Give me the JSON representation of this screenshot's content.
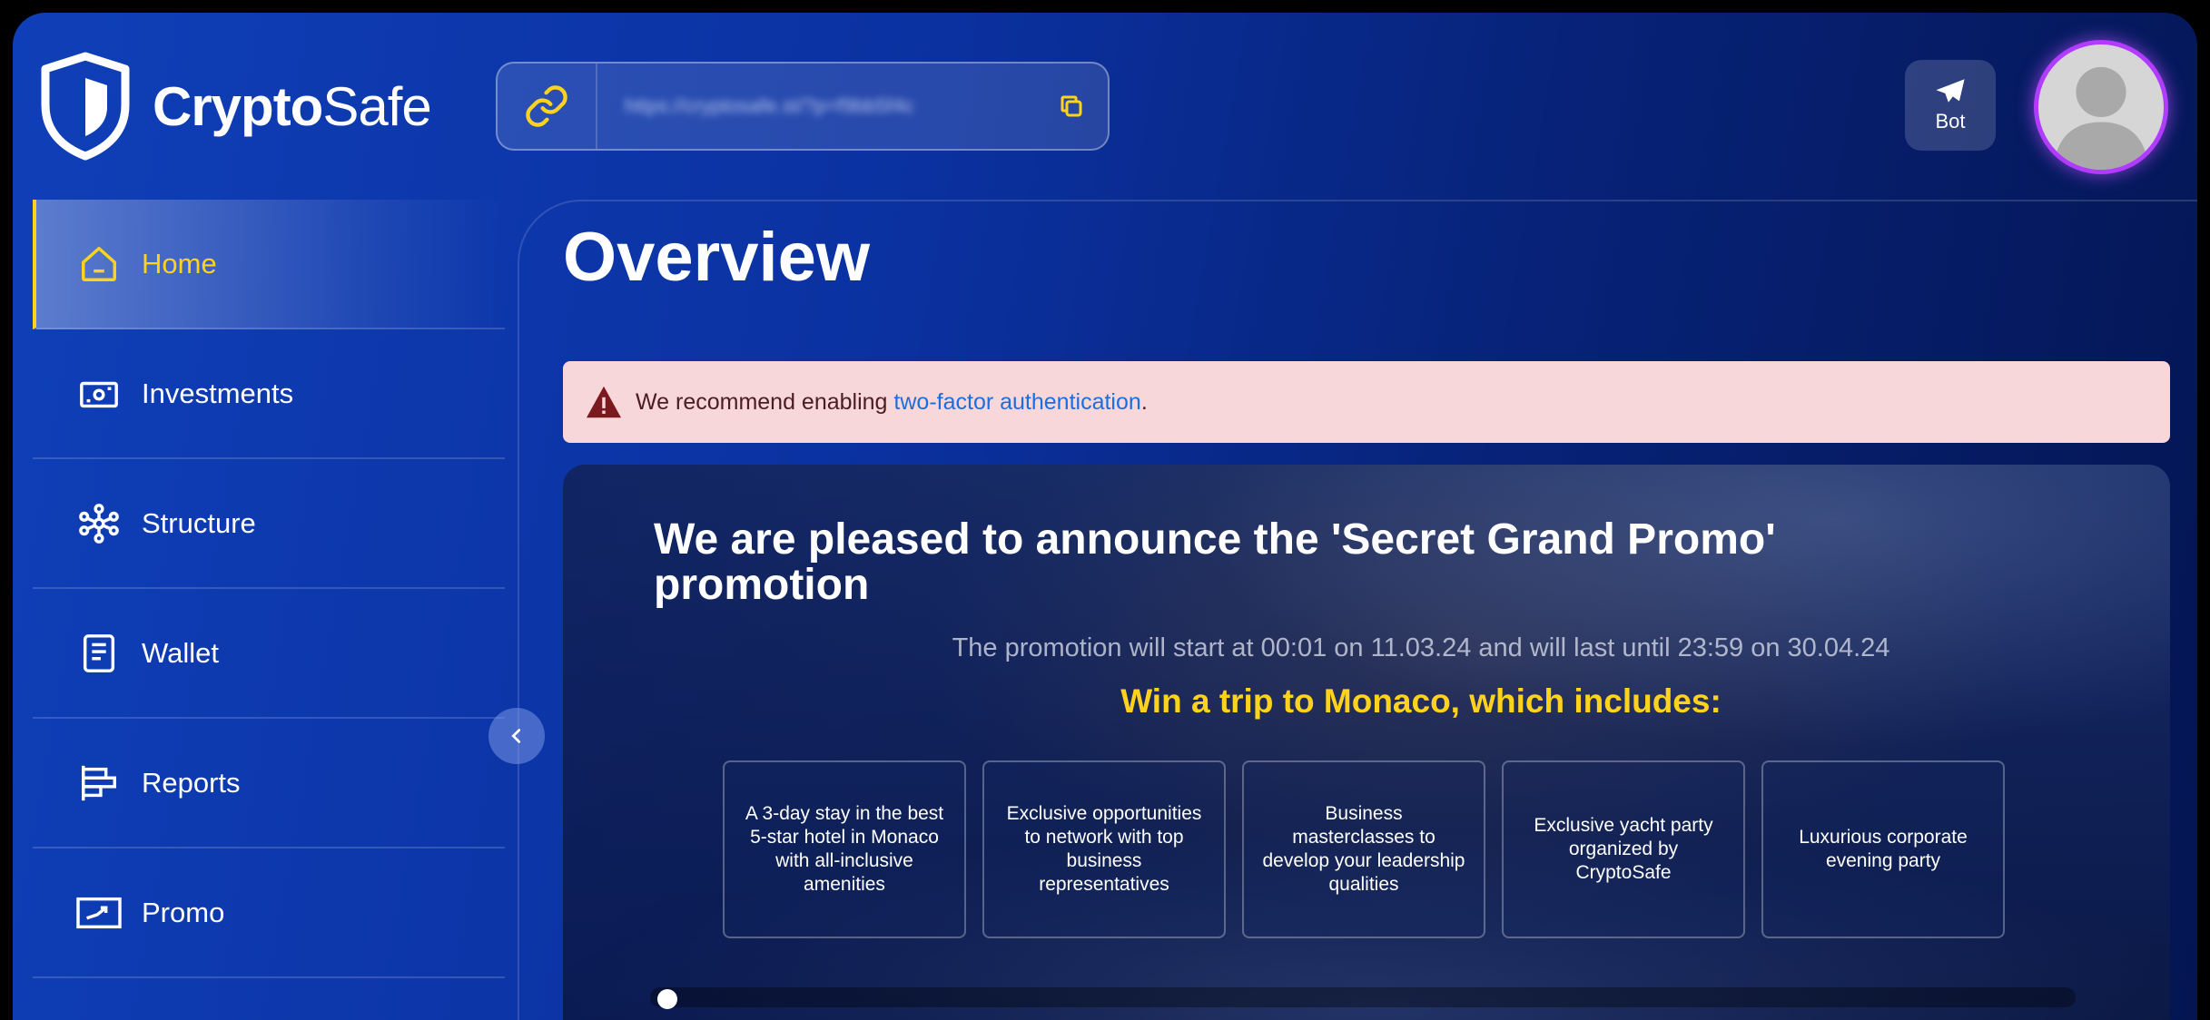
{
  "brand": {
    "name_bold": "Crypto",
    "name_light": "Safe"
  },
  "header": {
    "referral_url": "https://cryptosafe.st/?p=f9bb5f4c",
    "bot_label": "Bot"
  },
  "sidebar": {
    "items": [
      {
        "label": "Home",
        "icon": "home-icon",
        "active": true
      },
      {
        "label": "Investments",
        "icon": "investments-icon",
        "active": false
      },
      {
        "label": "Structure",
        "icon": "structure-icon",
        "active": false
      },
      {
        "label": "Wallet",
        "icon": "wallet-icon",
        "active": false
      },
      {
        "label": "Reports",
        "icon": "reports-icon",
        "active": false
      },
      {
        "label": "Promo",
        "icon": "promo-icon",
        "active": false
      }
    ]
  },
  "main": {
    "title": "Overview",
    "alert": {
      "prefix": "We recommend enabling ",
      "link": "two-factor authentication",
      "suffix": "."
    },
    "promo": {
      "title": "We are pleased to announce the 'Secret Grand Promo' promotion",
      "subtitle": "The promotion will start at 00:01 on 11.03.24 and will last until 23:59 on 30.04.24",
      "highlight": "Win a trip to Monaco, which includes:",
      "cards": [
        "A 3-day stay in the best 5-star hotel in Monaco with all-inclusive amenities",
        "Exclusive opportunities to network with top business representatives",
        "Business masterclasses to develop your leadership qualities",
        "Exclusive yacht party organized by CryptoSafe",
        "Luxurious corporate evening party"
      ]
    }
  },
  "colors": {
    "accent": "#ffd21e",
    "background": "#0b31a0",
    "alert_bg": "#f8d7da",
    "link": "#1a6fe0",
    "avatar_ring": "#b13cff"
  }
}
